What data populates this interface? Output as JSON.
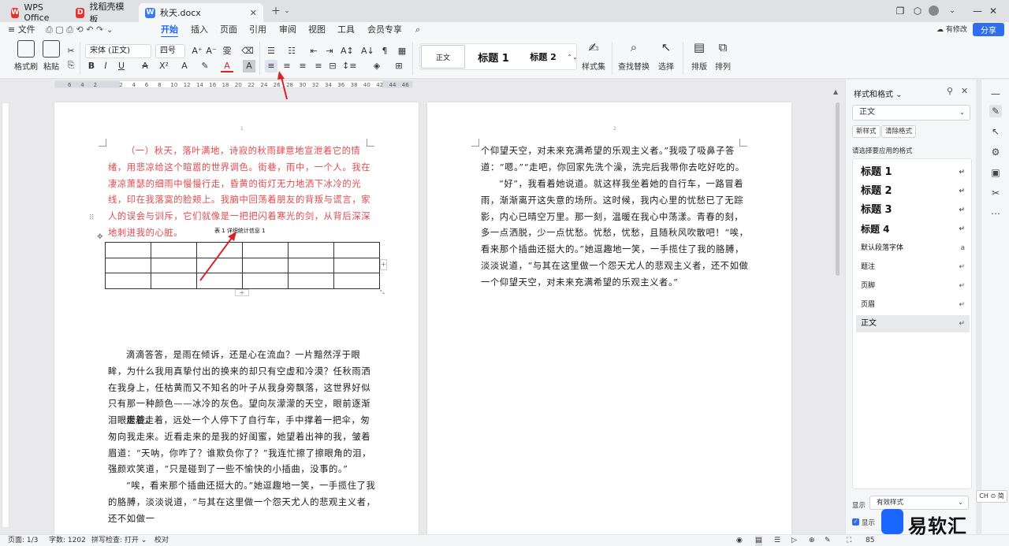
{
  "tabs": [
    {
      "label": "WPS Office"
    },
    {
      "label": "找稻壳模板"
    },
    {
      "label": "秋天.docx"
    }
  ],
  "menu": {
    "file": "文件",
    "items": [
      "开始",
      "插入",
      "页面",
      "引用",
      "审阅",
      "视图",
      "工具",
      "会员专享"
    ],
    "has_edit": "有修改",
    "share": "分享"
  },
  "ribbon": {
    "format_painter": "格式刷",
    "paste": "粘贴",
    "font_name": "宋体 (正文)",
    "font_size": "四号",
    "styles": [
      "正文",
      "标题 1",
      "标题 2"
    ],
    "style_set": "样式集",
    "find_replace": "查找替换",
    "select": "选择",
    "layout": "排版",
    "arrange": "排列"
  },
  "ruler": {
    "labels": [
      "6",
      "4",
      "2",
      "",
      "2",
      "4",
      "6",
      "8",
      "10",
      "12",
      "14",
      "16",
      "18",
      "20",
      "22",
      "24",
      "26",
      "28",
      "30",
      "32",
      "34",
      "36",
      "38",
      "40",
      "42",
      "44",
      "46"
    ]
  },
  "page1": {
    "number": "1",
    "red_para": "（一）秋天，落叶满地，诗寂的秋雨肆意地宣泄着它的情绪，用悲凉给这个暄嚣的世界调色。街巷，雨中，一个人。我在凄凉萧瑟的细雨中慢慢行走，昏黄的街灯无力地洒下冰冷的光线，印在我落寞的脸颊上。我脑中回荡着朋友的背叛与谎言，家人的误会与训斥，它们就像是一把把闪着寒光的剑，从背后深深地刺进我的心脏。",
    "table_caption": "表 1 详细统计信息 1",
    "para1": "滴滴答答，是雨在倾诉，还是心在流血？一片黯然浮于眼眸，为什么我用真挚付出的换来的却只有空虚和冷漠？任秋雨洒在我身上，任枯黄而又不知名的叶子从我身旁飘落，这世界好似只有那一种颜色——冰冷的灰色。望向灰濛濛的天空，眼前逐渐泪眼朦胧。",
    "para2": "走着走着，远处一个人停下了自行车，手中撑着一把伞，匆匆向我走来。近看走来的是我的好闺蜜，她望着出神的我，皱着眉道：“天呐，你咋了？谁欺负你了？”我连忙擦了擦眼角的泪，强颜欢笑道，“只是碰到了一些不愉快的小插曲，没事的。”",
    "para3": "“唉，看来那个插曲还挺大的。”她逗趣地一笑，一手揽住了我的胳膊，淡淡说道，“与其在这里做一个怨天尤人的悲观主义者，还不如做一"
  },
  "page2": {
    "number": "2",
    "para0": "个仰望天空，对未来充满希望的乐观主义者。”我吸了吸鼻子答道：“嗯。”“走吧，你回家先洗个澡，洗完后我带你去吃好吃的。",
    "para1": "“好”，我看着她说道。就这样我坐着她的自行车，一路冒着雨，渐渐离开这失意的场所。这时候，我内心里的忧愁已了无踪影，内心已晴空万里。那一刻，温暖在我心中荡漾。青春的刻，多一点洒脱，少一点忧愁。忧愁，忧愁，且随秋风吹散吧！“唉，看来那个插曲还挺大的。”她逗趣地一笑，一手揽住了我的胳膊，淡淡说道，“与其在这里做一个怨天尤人的悲观主义者，还不如做一个仰望天空，对未来充满希望的乐观主义者。”"
  },
  "panel": {
    "title": "样式和格式",
    "current": "正文",
    "new_style": "新样式",
    "clear_format": "清除格式",
    "choose_label": "请选择要应用的格式",
    "styles": [
      "标题 1",
      "标题 2",
      "标题 3",
      "标题 4",
      "默认段落字体",
      "题注",
      "页脚",
      "页眉",
      "正文"
    ],
    "show_label": "显示",
    "show_value": "有效样式",
    "show_check": "显示"
  },
  "ime": "CH ⊙ 简",
  "watermark": "易软汇",
  "status": {
    "page": "页面: 1/3",
    "words": "字数: 1202",
    "spell": "拼写检查: 打开",
    "proof": "校对",
    "zoom": "85"
  }
}
